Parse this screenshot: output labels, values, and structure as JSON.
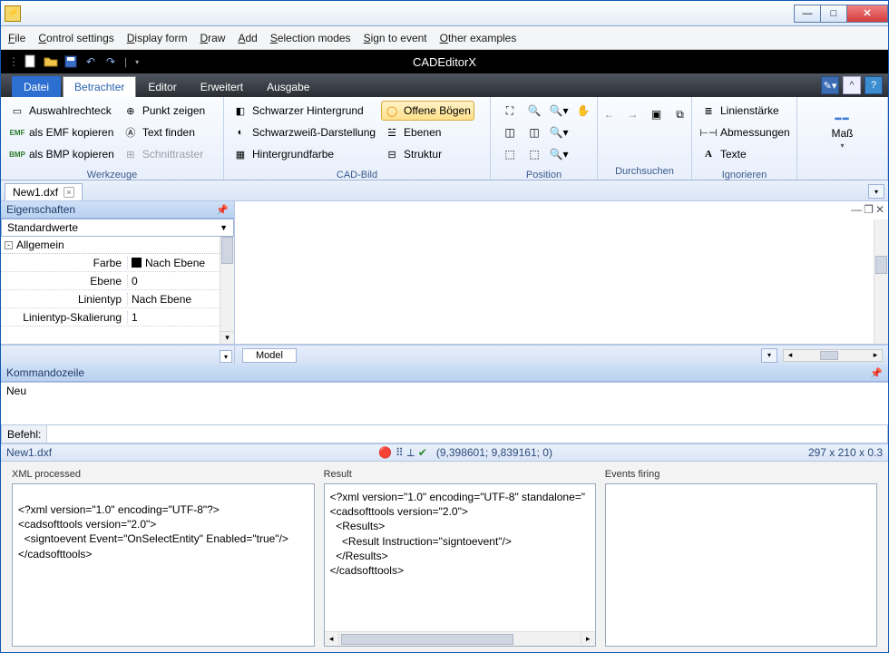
{
  "window": {
    "title": ""
  },
  "mainmenu": [
    "File",
    "Control settings",
    "Display form",
    "Draw",
    "Add",
    "Selection modes",
    "Sign to event",
    "Other examples"
  ],
  "quickbar": {
    "title": "CADEditorX"
  },
  "ribbon": {
    "file_tab": "Datei",
    "tabs": [
      "Betrachter",
      "Editor",
      "Erweitert",
      "Ausgabe"
    ],
    "active_tab": "Betrachter",
    "groups": {
      "werkzeuge": {
        "label": "Werkzeuge",
        "items": [
          "Auswahlrechteck",
          "als EMF kopieren",
          "als BMP kopieren",
          "Punkt zeigen",
          "Text finden",
          "Schnittraster"
        ]
      },
      "cadbild": {
        "label": "CAD-Bild",
        "items": [
          "Schwarzer Hintergrund",
          "Schwarzweiß-Darstellung",
          "Hintergrundfarbe",
          "Offene Bögen",
          "Ebenen",
          "Struktur"
        ]
      },
      "position": {
        "label": "Position"
      },
      "durchsuchen": {
        "label": "Durchsuchen"
      },
      "ignorieren": {
        "label": "Ignorieren",
        "items": [
          "Linienstärke",
          "Abmessungen",
          "Texte"
        ]
      },
      "mass": {
        "label": "Maß"
      }
    }
  },
  "filetab": {
    "name": "New1.dxf"
  },
  "properties": {
    "title": "Eigenschaften",
    "dropdown": "Standardwerte",
    "section": "Allgemein",
    "rows": [
      {
        "k": "Farbe",
        "v": "Nach Ebene"
      },
      {
        "k": "Ebene",
        "v": "0"
      },
      {
        "k": "Linientyp",
        "v": "Nach Ebene"
      },
      {
        "k": "Linientyp-Skalierung",
        "v": "1"
      }
    ]
  },
  "model_tab": "Model",
  "commandline": {
    "title": "Kommandozeile",
    "output": "Neu",
    "prompt": "Befehl:"
  },
  "status": {
    "file": "New1.dxf",
    "coords": "(9,398601; 9,839161; 0)",
    "dims": "297 x 210 x 0.3"
  },
  "bottom": {
    "xml_label": "XML processed",
    "xml_text": "<?xml version=\"1.0\" encoding=\"UTF-8\"?>\n<cadsofttools version=\"2.0\">\n  <signtoevent Event=\"OnSelectEntity\" Enabled=\"true\"/>\n</cadsofttools>",
    "result_label": "Result",
    "result_text": "<?xml version=\"1.0\" encoding=\"UTF-8\" standalone=\"\n<cadsofttools version=\"2.0\">\n  <Results>\n    <Result Instruction=\"signtoevent\"/>\n  </Results>\n</cadsofttools>",
    "events_label": "Events firing"
  }
}
